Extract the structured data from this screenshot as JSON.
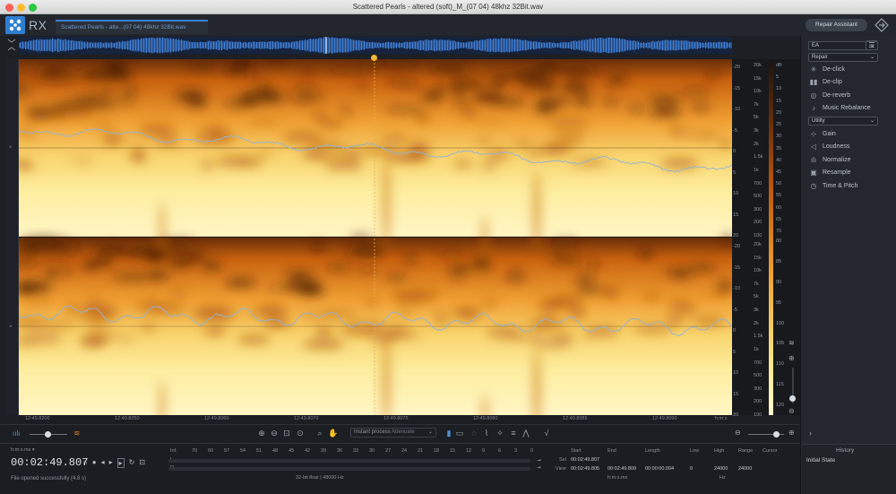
{
  "window": {
    "title": "Scattered Pearls - altered (soft)_M_(07 04) 48khz 32Bit.wav"
  },
  "app": {
    "logo_text": "RX"
  },
  "file_tab": {
    "label": "Scattered Pearls - alte...(07 04) 48khz 32Bit.wav"
  },
  "repair_assistant": {
    "label": "Repair Assistant"
  },
  "right_panel": {
    "preset_value": "EA",
    "repair_dropdown": "Repair",
    "repair_modules": [
      {
        "label": "De-click",
        "icon": "click-icon"
      },
      {
        "label": "De-clip",
        "icon": "clip-icon"
      },
      {
        "label": "De-reverb",
        "icon": "reverb-icon"
      },
      {
        "label": "Music Rebalance",
        "icon": "rebalance-icon"
      }
    ],
    "utility_dropdown": "Utility",
    "utility_modules": [
      {
        "label": "Gain",
        "icon": "gain-icon"
      },
      {
        "label": "Loudness",
        "icon": "loudness-icon"
      },
      {
        "label": "Normalize",
        "icon": "normalize-icon"
      },
      {
        "label": "Resample",
        "icon": "resample-icon"
      },
      {
        "label": "Time & Pitch",
        "icon": "time-pitch-icon"
      }
    ],
    "history_title": "History",
    "history_item": "Initial State"
  },
  "scale": {
    "db_labels": [
      "-20",
      "-15",
      "-10",
      "-5",
      "0",
      "5",
      "10",
      "15",
      "20"
    ],
    "hz_labels": [
      "20k",
      "15k",
      "10k",
      "7k",
      "5k",
      "3k",
      "2k",
      "1.5k",
      "1k",
      "700",
      "500",
      "300",
      "200",
      "100"
    ],
    "db2_labels": [
      "dB",
      "5",
      "10",
      "15",
      "20",
      "25",
      "30",
      "35",
      "40",
      "45",
      "50",
      "55",
      "60",
      "65",
      "70"
    ],
    "right_numbers": [
      "80",
      "85",
      "90",
      "95",
      "100",
      "105",
      "110",
      "115",
      "120"
    ]
  },
  "time_ruler": {
    "labels": [
      "12:49.8200",
      "12:49.8050",
      "12:49.8060",
      "12:49.8070",
      "12:49.8075",
      "12:49.8080",
      "12:49.8085",
      "12:49.8090"
    ],
    "unit": "h:m:s"
  },
  "toolbar": {
    "instant_process_label": "Instant process",
    "instant_process_mode": "Attenuate"
  },
  "transport": {
    "time_format": "h:m:s.ms",
    "time": "00:02:49.807",
    "status": "File opened successfully (4.8 s)"
  },
  "meter": {
    "label": "Inf.",
    "ticks": [
      "70",
      "60",
      "57",
      "54",
      "51",
      "48",
      "45",
      "42",
      "39",
      "36",
      "33",
      "30",
      "27",
      "24",
      "21",
      "18",
      "15",
      "12",
      "9",
      "6",
      "3",
      "0"
    ],
    "left_channel": "L",
    "right_channel": "R",
    "format": "32-bit float | 48000 Hz"
  },
  "selection": {
    "headers": [
      "Start",
      "End",
      "Length",
      "Low",
      "High",
      "Range",
      "Cursor"
    ],
    "sel_label": "Sel",
    "sel_start": "00:02:49.807",
    "view_label": "View",
    "view_start": "00:02:49.805",
    "view_end": "00:02:49.809",
    "view_length": "00:00:00.004",
    "low": "0",
    "high": "24000",
    "range": "24000",
    "time_unit": "h:m:s.ms",
    "freq_unit": "Hz"
  },
  "colors": {
    "accent": "#2e7fd0",
    "waveform_line": "#8fb4d8"
  }
}
